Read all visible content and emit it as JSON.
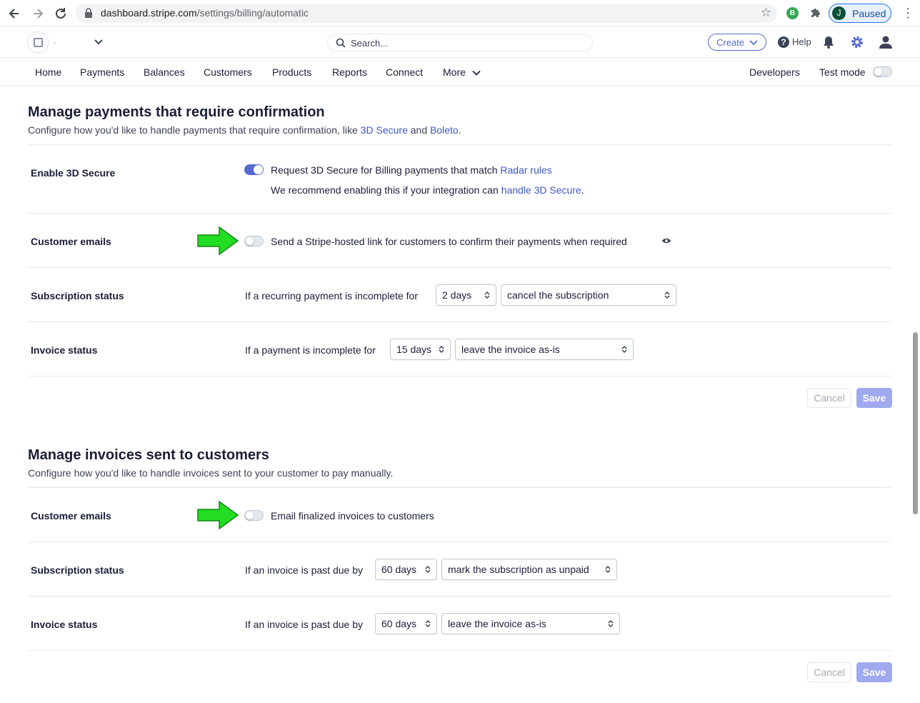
{
  "browser": {
    "url_host": "dashboard.stripe.com",
    "url_path": "/settings/billing/automatic",
    "extension_badge": "B",
    "profile_initial": "J",
    "profile_status": "Paused"
  },
  "header": {
    "account_name": "·",
    "search_placeholder": "Search...",
    "create_label": "Create",
    "help_label": "Help"
  },
  "nav": {
    "items": [
      "Home",
      "Payments",
      "Balances",
      "Customers",
      "Products",
      "Reports",
      "Connect",
      "More"
    ],
    "developers": "Developers",
    "test_mode": "Test mode"
  },
  "section1": {
    "title": "Manage payments that require confirmation",
    "desc_prefix": "Configure how you'd like to handle payments that require confirmation, like ",
    "desc_link1": "3D Secure",
    "desc_and": " and ",
    "desc_link2": "Boleto",
    "desc_suffix": ".",
    "secure": {
      "label": "Enable 3D Secure",
      "text": "Request 3D Secure for Billing payments that match ",
      "link": "Radar rules",
      "sub_text": "We recommend enabling this if your integration can ",
      "sub_link": "handle 3D Secure",
      "sub_suffix": ".",
      "enabled": true
    },
    "emails": {
      "label": "Customer emails",
      "text": "Send a Stripe-hosted link for customers to confirm their payments when required",
      "enabled": false
    },
    "subscription": {
      "label": "Subscription status",
      "text": "If a recurring payment is incomplete for",
      "period": "2 days",
      "action": "cancel the subscription"
    },
    "invoice": {
      "label": "Invoice status",
      "text": "If a payment is incomplete for",
      "period": "15 days",
      "action": "leave the invoice as-is"
    },
    "cancel": "Cancel",
    "save": "Save"
  },
  "section2": {
    "title": "Manage invoices sent to customers",
    "desc": "Configure how you'd like to handle invoices sent to your customer to pay manually.",
    "emails": {
      "label": "Customer emails",
      "text": "Email finalized invoices to customers",
      "enabled": false
    },
    "subscription": {
      "label": "Subscription status",
      "text": "If an invoice is past due by",
      "period": "60 days",
      "action": "mark the subscription as unpaid"
    },
    "invoice": {
      "label": "Invoice status",
      "text": "If an invoice is past due by",
      "period": "60 days",
      "action": "leave the invoice as-is"
    },
    "cancel": "Cancel",
    "save": "Save"
  },
  "colors": {
    "accent": "#5469d4",
    "link": "#3f57c5",
    "arrow": "#22dd22"
  }
}
